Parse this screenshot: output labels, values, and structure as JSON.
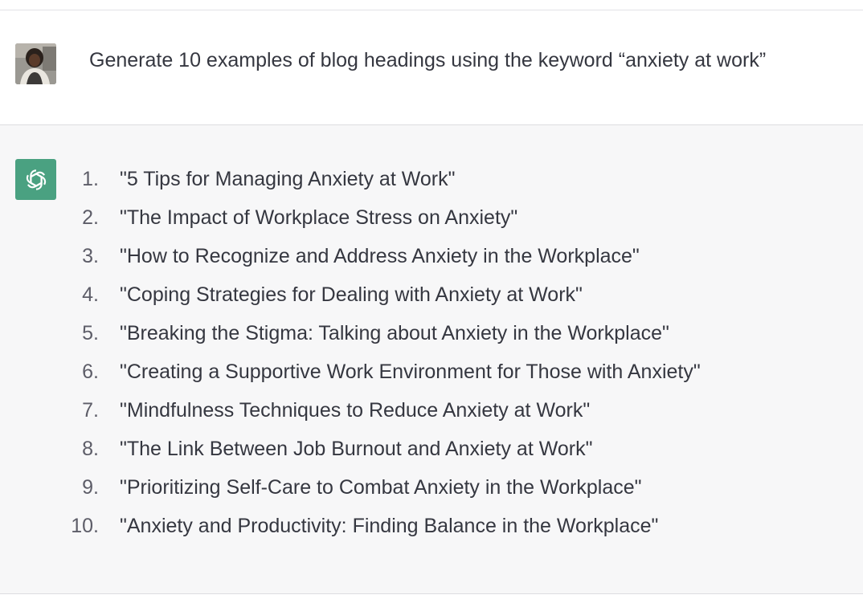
{
  "user": {
    "avatar_icon": "user-photo-avatar",
    "message": "Generate 10 examples of blog headings using the keyword “anxiety at work”"
  },
  "assistant": {
    "avatar_icon": "openai-logo-icon",
    "avatar_color": "#4aa181",
    "items": [
      {
        "num": "1.",
        "text": "\"5 Tips for Managing Anxiety at Work\""
      },
      {
        "num": "2.",
        "text": "\"The Impact of Workplace Stress on Anxiety\""
      },
      {
        "num": "3.",
        "text": "\"How to Recognize and Address Anxiety in the Workplace\""
      },
      {
        "num": "4.",
        "text": "\"Coping Strategies for Dealing with Anxiety at Work\""
      },
      {
        "num": "5.",
        "text": "\"Breaking the Stigma: Talking about Anxiety in the Workplace\""
      },
      {
        "num": "6.",
        "text": "\"Creating a Supportive Work Environment for Those with Anxiety\""
      },
      {
        "num": "7.",
        "text": "\"Mindfulness Techniques to Reduce Anxiety at Work\""
      },
      {
        "num": "8.",
        "text": "\"The Link Between Job Burnout and Anxiety at Work\""
      },
      {
        "num": "9.",
        "text": "\"Prioritizing Self-Care to Combat Anxiety in the Workplace\""
      },
      {
        "num": "10.",
        "text": "\"Anxiety and Productivity: Finding Balance in the Workplace\""
      }
    ]
  },
  "colors": {
    "text": "#353740",
    "assistant_bg": "#f7f7f8",
    "user_bg": "#ffffff"
  }
}
